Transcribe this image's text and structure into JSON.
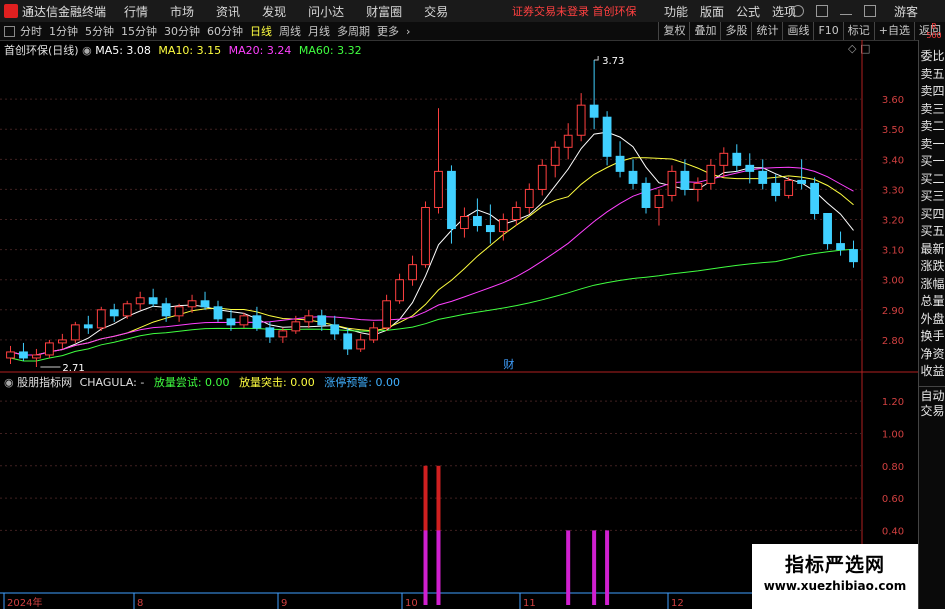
{
  "menubar": {
    "app_title": "通达信金融终端",
    "items": [
      "行情",
      "市场",
      "资讯",
      "发现",
      "问小达",
      "财富圈",
      "交易"
    ],
    "notice": "证券交易未登录  首创环保",
    "right_items": [
      "功能",
      "版面",
      "公式",
      "选项"
    ],
    "user": "游客"
  },
  "toolbar": {
    "periods": [
      "分时",
      "1分钟",
      "5分钟",
      "15分钟",
      "30分钟",
      "60分钟",
      "日线",
      "周线",
      "月线",
      "多周期",
      "更多"
    ],
    "active_period": "日线",
    "right_buttons": [
      "复权",
      "叠加",
      "多股",
      "统计",
      "画线",
      "F10",
      "标记",
      "+自选",
      "返回"
    ]
  },
  "main_chart": {
    "stock_label": "首创环保(日线)",
    "ma": [
      {
        "label": "MA5: 3.08",
        "color": "#ffffff"
      },
      {
        "label": "MA10: 3.15",
        "color": "#ffff40"
      },
      {
        "label": "MA20: 3.24",
        "color": "#ff40ff"
      },
      {
        "label": "MA60: 3.32",
        "color": "#40ff40"
      }
    ],
    "high_label": "3.73",
    "low_label": "2.71",
    "event_marker": "财",
    "y_labels": [
      "3.60",
      "3.50",
      "3.40",
      "3.30",
      "3.20",
      "3.10",
      "3.00",
      "2.90",
      "2.80"
    ]
  },
  "indicator": {
    "name": "股朋指标网",
    "formula": "CHAGULA: -",
    "items": [
      {
        "label": "放量尝试: 0.00",
        "color": "#40ff40"
      },
      {
        "label": "放量突击: 0.00",
        "color": "#ffff40"
      },
      {
        "label": "涨停预警: 0.00",
        "color": "#40b0ff"
      }
    ],
    "y_labels": [
      "1.20",
      "1.00",
      "0.80",
      "0.60",
      "0.40"
    ]
  },
  "x_axis": [
    "2024年",
    "8",
    "9",
    "10",
    "11",
    "12"
  ],
  "sidebar": {
    "badge": "R 500",
    "tabs": [
      "委比",
      "卖五",
      "卖四",
      "卖三",
      "卖二",
      "卖一",
      "买一",
      "买二",
      "买三",
      "买四",
      "买五",
      "最新",
      "涨跌",
      "涨幅",
      "总量",
      "外盘",
      "换手",
      "净资",
      "收益"
    ],
    "auto_trade": [
      "自动",
      "交易"
    ]
  },
  "watermark": {
    "title": "指标严选网",
    "url": "www.xuezhibiao.com"
  },
  "chart_data": {
    "type": "candlestick",
    "ylim": [
      2.7,
      3.75
    ],
    "ohlc": [
      [
        2.74,
        2.78,
        2.72,
        2.76
      ],
      [
        2.76,
        2.79,
        2.73,
        2.74
      ],
      [
        2.74,
        2.77,
        2.71,
        2.75
      ],
      [
        2.75,
        2.8,
        2.74,
        2.79
      ],
      [
        2.79,
        2.82,
        2.77,
        2.8
      ],
      [
        2.8,
        2.86,
        2.79,
        2.85
      ],
      [
        2.85,
        2.88,
        2.82,
        2.84
      ],
      [
        2.84,
        2.91,
        2.83,
        2.9
      ],
      [
        2.9,
        2.92,
        2.86,
        2.88
      ],
      [
        2.88,
        2.93,
        2.87,
        2.92
      ],
      [
        2.92,
        2.96,
        2.9,
        2.94
      ],
      [
        2.94,
        2.97,
        2.91,
        2.92
      ],
      [
        2.92,
        2.94,
        2.86,
        2.88
      ],
      [
        2.88,
        2.92,
        2.86,
        2.91
      ],
      [
        2.91,
        2.95,
        2.89,
        2.93
      ],
      [
        2.93,
        2.96,
        2.9,
        2.91
      ],
      [
        2.91,
        2.93,
        2.86,
        2.87
      ],
      [
        2.87,
        2.9,
        2.83,
        2.85
      ],
      [
        2.85,
        2.89,
        2.84,
        2.88
      ],
      [
        2.88,
        2.91,
        2.83,
        2.84
      ],
      [
        2.84,
        2.86,
        2.79,
        2.81
      ],
      [
        2.81,
        2.84,
        2.79,
        2.83
      ],
      [
        2.83,
        2.88,
        2.82,
        2.86
      ],
      [
        2.86,
        2.9,
        2.84,
        2.88
      ],
      [
        2.88,
        2.9,
        2.83,
        2.85
      ],
      [
        2.85,
        2.88,
        2.8,
        2.82
      ],
      [
        2.82,
        2.84,
        2.75,
        2.77
      ],
      [
        2.77,
        2.82,
        2.76,
        2.8
      ],
      [
        2.8,
        2.86,
        2.79,
        2.84
      ],
      [
        2.84,
        2.95,
        2.83,
        2.93
      ],
      [
        2.93,
        3.02,
        2.92,
        3.0
      ],
      [
        3.0,
        3.08,
        2.98,
        3.05
      ],
      [
        3.05,
        3.26,
        3.04,
        3.24
      ],
      [
        3.24,
        3.57,
        3.22,
        3.36
      ],
      [
        3.36,
        3.38,
        3.12,
        3.17
      ],
      [
        3.17,
        3.24,
        3.14,
        3.21
      ],
      [
        3.21,
        3.27,
        3.16,
        3.18
      ],
      [
        3.18,
        3.25,
        3.12,
        3.16
      ],
      [
        3.16,
        3.22,
        3.13,
        3.2
      ],
      [
        3.2,
        3.26,
        3.18,
        3.24
      ],
      [
        3.24,
        3.32,
        3.22,
        3.3
      ],
      [
        3.3,
        3.4,
        3.28,
        3.38
      ],
      [
        3.38,
        3.46,
        3.34,
        3.44
      ],
      [
        3.44,
        3.52,
        3.4,
        3.48
      ],
      [
        3.48,
        3.62,
        3.46,
        3.58
      ],
      [
        3.58,
        3.73,
        3.5,
        3.54
      ],
      [
        3.54,
        3.56,
        3.38,
        3.41
      ],
      [
        3.41,
        3.46,
        3.34,
        3.36
      ],
      [
        3.36,
        3.4,
        3.3,
        3.32
      ],
      [
        3.32,
        3.34,
        3.22,
        3.24
      ],
      [
        3.24,
        3.3,
        3.18,
        3.28
      ],
      [
        3.28,
        3.38,
        3.26,
        3.36
      ],
      [
        3.36,
        3.4,
        3.28,
        3.3
      ],
      [
        3.3,
        3.34,
        3.26,
        3.32
      ],
      [
        3.32,
        3.4,
        3.3,
        3.38
      ],
      [
        3.38,
        3.44,
        3.34,
        3.42
      ],
      [
        3.42,
        3.45,
        3.36,
        3.38
      ],
      [
        3.38,
        3.42,
        3.32,
        3.36
      ],
      [
        3.36,
        3.4,
        3.3,
        3.32
      ],
      [
        3.32,
        3.35,
        3.26,
        3.28
      ],
      [
        3.28,
        3.34,
        3.27,
        3.33
      ],
      [
        3.33,
        3.4,
        3.3,
        3.32
      ],
      [
        3.32,
        3.34,
        3.2,
        3.22
      ],
      [
        3.22,
        3.16,
        3.1,
        3.12
      ],
      [
        3.12,
        3.16,
        3.08,
        3.1
      ],
      [
        3.1,
        3.13,
        3.04,
        3.06
      ]
    ],
    "indicator_bars": [
      {
        "index": 32,
        "value": 0.8,
        "color": "#d02020"
      },
      {
        "index": 33,
        "value": 0.8,
        "color": "#d02020"
      },
      {
        "index": 32,
        "value": 0.4,
        "color": "#d020d0"
      },
      {
        "index": 33,
        "value": 0.4,
        "color": "#d020d0"
      },
      {
        "index": 43,
        "value": 0.4,
        "color": "#d020d0"
      },
      {
        "index": 45,
        "value": 0.4,
        "color": "#d020d0"
      },
      {
        "index": 46,
        "value": 0.4,
        "color": "#d020d0"
      }
    ]
  }
}
